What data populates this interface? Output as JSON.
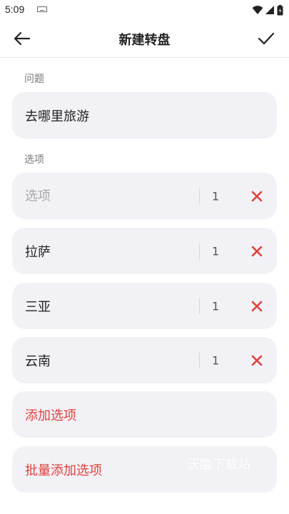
{
  "status": {
    "time": "5:09"
  },
  "header": {
    "title": "新建转盘"
  },
  "question": {
    "label": "问题",
    "value": "去哪里旅游"
  },
  "options": {
    "label": "选项",
    "new_option": {
      "placeholder": "选项",
      "weight": "1"
    },
    "items": [
      {
        "label": "拉萨",
        "weight": "1"
      },
      {
        "label": "三亚",
        "weight": "1"
      },
      {
        "label": "云南",
        "weight": "1"
      }
    ]
  },
  "actions": {
    "add_option": "添加选项",
    "batch_add": "批量添加选项"
  },
  "watermark": "沃隐下载站",
  "colors": {
    "accent": "#e0413a",
    "card": "#f2f1f6"
  }
}
